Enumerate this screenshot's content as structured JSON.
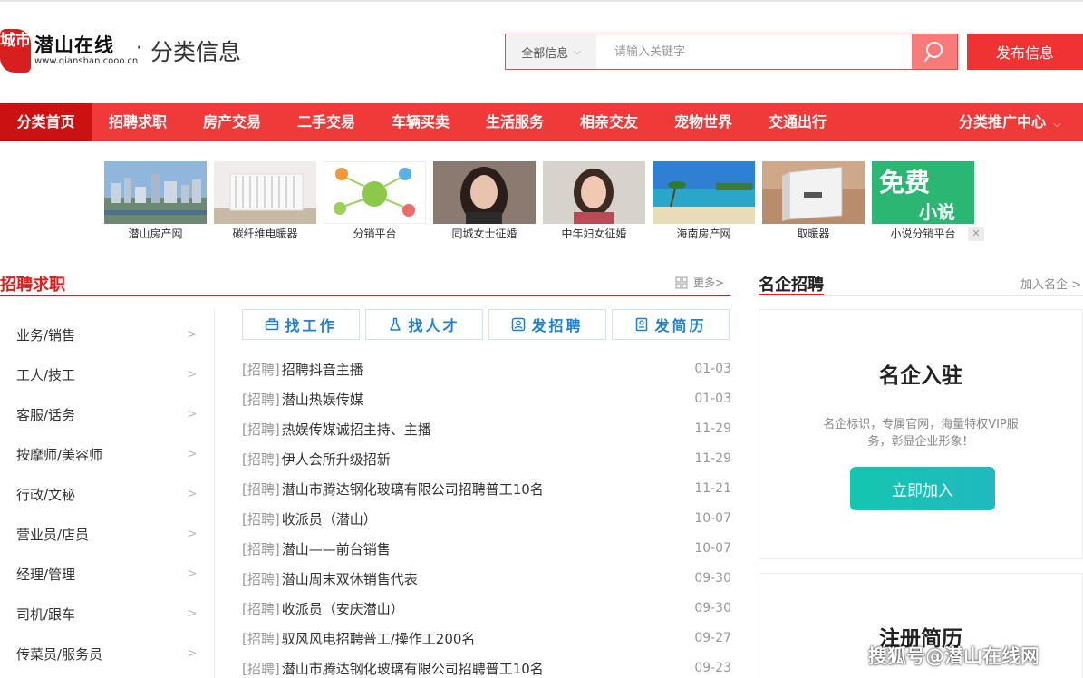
{
  "header": {
    "logo_seal": "城市",
    "logo_name": "潜山在线",
    "logo_url": "www.qianshan.cooo.cn",
    "site_dot": "·",
    "site_title": "分类信息",
    "search_category": "全部信息",
    "search_placeholder": "请输入关键字",
    "publish_label": "发布信息"
  },
  "nav": {
    "items": [
      "分类首页",
      "招聘求职",
      "房产交易",
      "二手交易",
      "车辆买卖",
      "生活服务",
      "相亲交友",
      "宠物世界",
      "交通出行"
    ],
    "promo": "分类推广中心"
  },
  "ads": [
    {
      "label": "潜山房产网",
      "icon": "city-skyline"
    },
    {
      "label": "碳纤维电暖器",
      "icon": "radiator"
    },
    {
      "label": "分销平台",
      "icon": "diagram"
    },
    {
      "label": "同城女士征婚",
      "icon": "woman-portrait"
    },
    {
      "label": "中年妇女征婚",
      "icon": "woman-portrait"
    },
    {
      "label": "海南房产网",
      "icon": "beach"
    },
    {
      "label": "取暖器",
      "icon": "heater"
    },
    {
      "label": "小说分销平台",
      "icon": "novel"
    }
  ],
  "ad_extra": {
    "free_text": "免费",
    "novel_text": "小说",
    "close": "✕"
  },
  "jobs_section": {
    "title": "招聘求职",
    "more": "更多>",
    "categories": [
      "业务/销售",
      "工人/技工",
      "客服/话务",
      "按摩师/美容师",
      "行政/文秘",
      "营业员/店员",
      "经理/管理",
      "司机/跟车",
      "传菜员/服务员"
    ],
    "quick_buttons": [
      "找工作",
      "找人才",
      "发招聘",
      "发简历"
    ],
    "items": [
      {
        "tag": "[招聘]",
        "title": "招聘抖音主播",
        "date": "01-03"
      },
      {
        "tag": "[招聘]",
        "title": "潜山热娱传媒",
        "date": "01-03"
      },
      {
        "tag": "[招聘]",
        "title": "热娱传媒诚招主持、主播",
        "date": "11-29"
      },
      {
        "tag": "[招聘]",
        "title": "伊人会所升级招新",
        "date": "11-29"
      },
      {
        "tag": "[招聘]",
        "title": "潜山市腾达钢化玻璃有限公司招聘普工10名",
        "date": "11-21"
      },
      {
        "tag": "[招聘]",
        "title": "收派员（潜山）",
        "date": "10-07"
      },
      {
        "tag": "[招聘]",
        "title": "潜山——前台销售",
        "date": "10-07"
      },
      {
        "tag": "[招聘]",
        "title": "潜山周末双休销售代表",
        "date": "09-30"
      },
      {
        "tag": "[招聘]",
        "title": "收派员（安庆潜山）",
        "date": "09-30"
      },
      {
        "tag": "[招聘]",
        "title": "驭风风电招聘普工/操作工200名",
        "date": "09-27"
      },
      {
        "tag": "[招聘]",
        "title": "潜山市腾达钢化玻璃有限公司招聘普工10名",
        "date": "09-23"
      }
    ]
  },
  "famous": {
    "title": "名企招聘",
    "more": "加入名企 >",
    "card_heading": "名企入驻",
    "card_text": "名企标识，专属官网，海量特权VIP服务，彰显企业形象！",
    "join_label": "立即加入",
    "resume_heading": "注册简历"
  },
  "watermark": "搜狐号@潜山在线网",
  "colors": {
    "brand_red": "#f03a3a",
    "active_red": "#cc1111",
    "accent_blue": "#1f7fd0",
    "teal": "#14c6b0"
  }
}
